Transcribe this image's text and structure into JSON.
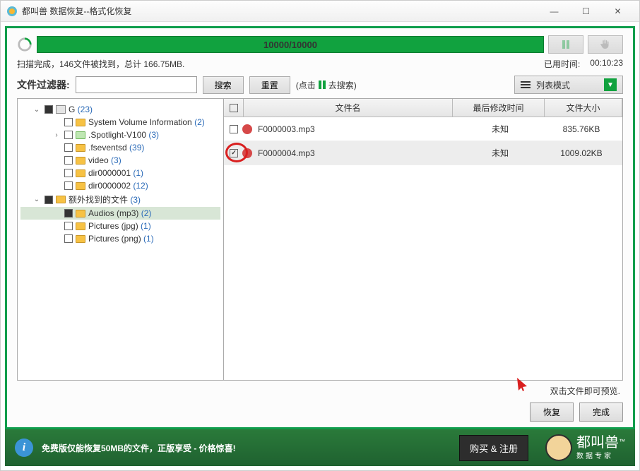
{
  "window": {
    "title": "都叫兽 数据恢复--格式化恢复"
  },
  "progress": {
    "text": "10000/10000"
  },
  "status": {
    "scan": "扫描完成，146文件被找到，总计 166.75MB.",
    "elapsed_label": "已用时间:",
    "elapsed": "00:10:23"
  },
  "filter": {
    "label": "文件过滤器:",
    "search": "搜索",
    "reset": "重置",
    "click_hint_pre": "(点击",
    "click_hint_post": "去搜索)",
    "view_mode": "列表模式"
  },
  "tree": [
    {
      "indent": 0,
      "chev": "down",
      "chk": "filled",
      "icon": "drive",
      "label": "G",
      "count": "(23)"
    },
    {
      "indent": 1,
      "chev": "",
      "chk": "",
      "icon": "folder",
      "label": "System Volume Information",
      "count": "(2)"
    },
    {
      "indent": 1,
      "chev": "right",
      "chk": "",
      "icon": "folder-green",
      "label": ".Spotlight-V100",
      "count": "(3)"
    },
    {
      "indent": 1,
      "chev": "",
      "chk": "",
      "icon": "folder",
      "label": ".fseventsd",
      "count": "(39)"
    },
    {
      "indent": 1,
      "chev": "",
      "chk": "",
      "icon": "folder",
      "label": "video",
      "count": "(3)"
    },
    {
      "indent": 1,
      "chev": "",
      "chk": "",
      "icon": "folder",
      "label": "dir0000001",
      "count": "(1)"
    },
    {
      "indent": 1,
      "chev": "",
      "chk": "",
      "icon": "folder",
      "label": "dir0000002",
      "count": "(12)"
    },
    {
      "indent": 0,
      "chev": "down",
      "chk": "filled",
      "icon": "folder",
      "label": "额外找到的文件",
      "count": "(3)"
    },
    {
      "indent": 1,
      "chev": "",
      "chk": "filled",
      "icon": "folder",
      "label": "Audios (mp3)",
      "count": "(2)",
      "selected": true
    },
    {
      "indent": 1,
      "chev": "",
      "chk": "",
      "icon": "folder",
      "label": "Pictures (jpg)",
      "count": "(1)"
    },
    {
      "indent": 1,
      "chev": "",
      "chk": "",
      "icon": "folder",
      "label": "Pictures (png)",
      "count": "(1)"
    }
  ],
  "list": {
    "headers": {
      "name": "文件名",
      "mod": "最后修改时间",
      "size": "文件大小"
    },
    "rows": [
      {
        "checked": false,
        "name": "F0000003.mp3",
        "mod": "未知",
        "size": "835.76KB",
        "highlight": false
      },
      {
        "checked": true,
        "name": "F0000004.mp3",
        "mod": "未知",
        "size": "1009.02KB",
        "highlight": true
      }
    ]
  },
  "hints": {
    "preview": "双击文件即可预览."
  },
  "actions": {
    "recover": "恢复",
    "finish": "完成"
  },
  "footer": {
    "msg": "免费版仅能恢复50MB的文件，正版享受 - 价格惊喜!",
    "buy": "购买 & 注册",
    "brand": "都叫兽",
    "brand_sub": "数据专家"
  }
}
